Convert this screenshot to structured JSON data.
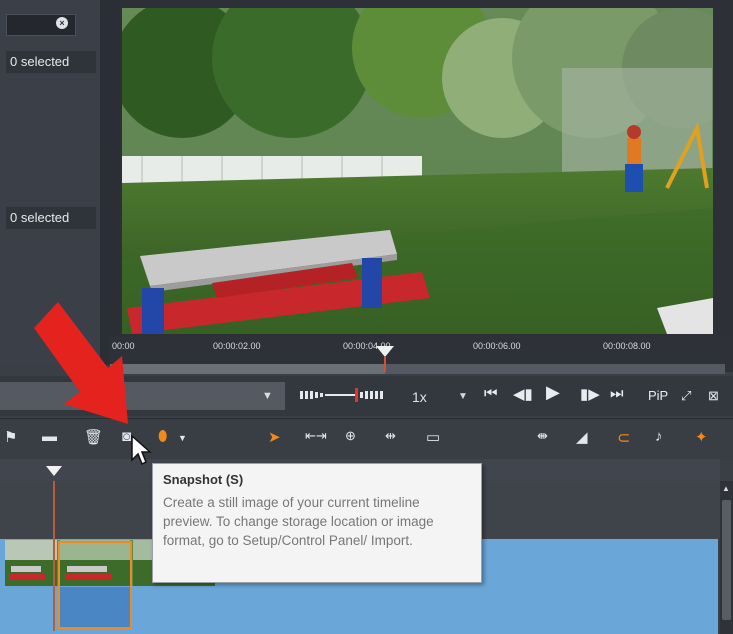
{
  "left_panel": {
    "top_selection": "0 selected",
    "bottom_selection": "0 selected",
    "clear_symbol": "×"
  },
  "ruler": {
    "ticks": [
      "00:00",
      "00:00:02.00",
      "00:00:04.00",
      "00:00:06.00",
      "00:00:08.00"
    ]
  },
  "transport": {
    "speed": "1x",
    "pip_label": "PiP",
    "icons": [
      "go-to-start-icon",
      "step-back-icon",
      "play-icon",
      "step-forward-icon",
      "go-to-end-icon"
    ]
  },
  "toolbar": {
    "icons": [
      "marker-icon",
      "delete-icon",
      "snapshot-icon",
      "color-marker-icon",
      "pointer-icon",
      "trim-icon",
      "split-icon",
      "slip-icon",
      "aspect-icon",
      "ripple-icon",
      "transition-icon",
      "magnet-icon",
      "audio-icon",
      "more-icon"
    ]
  },
  "tooltip": {
    "title": "Snapshot (S)",
    "body": "Create a still image of your current timeline preview. To change storage location or image format, go to Setup/Control Panel/ Import."
  },
  "colors": {
    "accent": "#f18a1a",
    "track_blue": "#6aa6d8",
    "annotation_red": "#e5231e"
  }
}
